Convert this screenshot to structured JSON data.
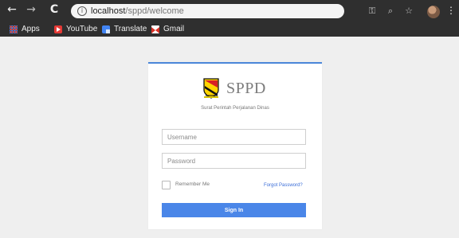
{
  "browser": {
    "url_host": "localhost",
    "url_path": "/sppd/welcome",
    "info_symbol": "i",
    "bookmarks": [
      {
        "label": "Apps",
        "icon": "apps-icon"
      },
      {
        "label": "YouTube",
        "icon": "youtube-icon"
      },
      {
        "label": "Translate",
        "icon": "translate-icon"
      },
      {
        "label": "Gmail",
        "icon": "gmail-icon"
      }
    ],
    "controls": {
      "back": "←",
      "forward": "→",
      "reload": "C",
      "key": "⚿",
      "search": "⌕",
      "star": "☆",
      "menu": "⋮"
    }
  },
  "login": {
    "logo_text": "SPPD",
    "subtitle": "Surat Perintah Perjalanan Dinas",
    "username_placeholder": "Username",
    "password_placeholder": "Password",
    "remember_label": "Remember Me",
    "forgot_label": "Forgot Password?",
    "signin_label": "Sign In"
  },
  "colors": {
    "browser_bg": "#2f2f2f",
    "page_bg": "#efefef",
    "accent_blue": "#4a86e8",
    "link_blue": "#3b6ed8"
  }
}
